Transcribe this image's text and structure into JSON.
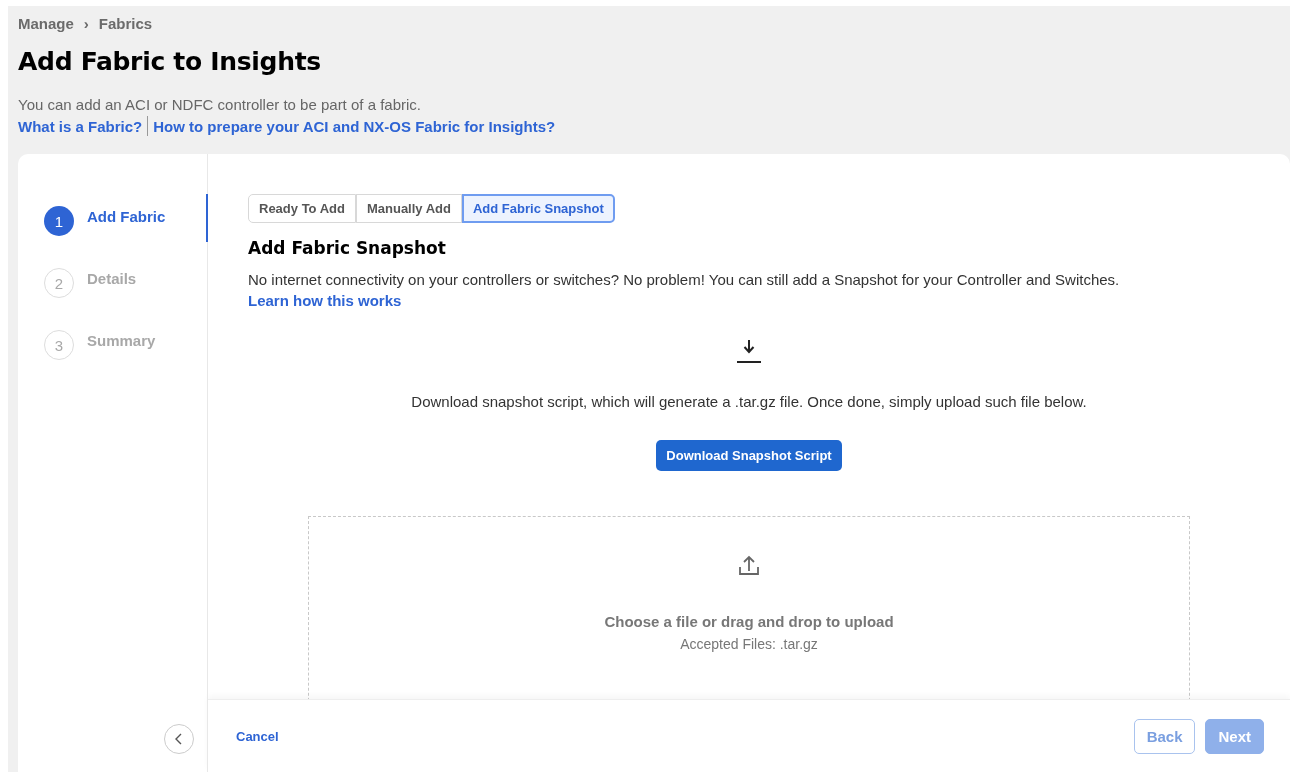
{
  "breadcrumb": [
    "Manage",
    "Fabrics"
  ],
  "breadcrumb_separator": "›",
  "title": "Add Fabric to Insights",
  "description": "You can add an ACI or NDFC controller to be part of a fabric.",
  "help_links": [
    "What is a Fabric?",
    "How to prepare your ACI and NX-OS Fabric for Insights?"
  ],
  "steps": [
    {
      "number": "1",
      "label": "Add Fabric",
      "selected": true,
      "disabled": false
    },
    {
      "number": "2",
      "label": "Details",
      "selected": false,
      "disabled": true
    },
    {
      "number": "3",
      "label": "Summary",
      "selected": false,
      "disabled": true
    }
  ],
  "tabs": [
    {
      "label": "Ready To Add",
      "selected": false
    },
    {
      "label": "Manually Add",
      "selected": false
    },
    {
      "label": "Add Fabric Snapshot",
      "selected": true
    }
  ],
  "section_title": "Add Fabric Snapshot",
  "section_text": "No internet connectivity on your controllers or switches? No problem! You can still add a Snapshot for your Controller and Switches.",
  "learn_link": "Learn how this works",
  "download_text": "Download snapshot script, which will generate a .tar.gz file. Once done, simply upload such file below.",
  "download_button": "Download Snapshot Script",
  "upload": {
    "prompt": "Choose a file or drag and drop to upload",
    "accepted": "Accepted Files: .tar.gz"
  },
  "footer": {
    "cancel": "Cancel",
    "back": {
      "label": "Back",
      "disabled": true
    },
    "next": {
      "label": "Next",
      "disabled": true
    }
  }
}
